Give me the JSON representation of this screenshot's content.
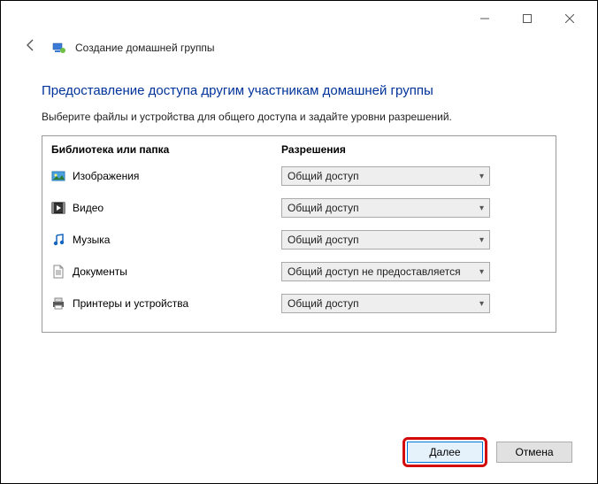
{
  "window": {
    "title": "Создание домашней группы"
  },
  "heading": "Предоставление доступа другим участникам домашней группы",
  "instruction": "Выберите файлы и устройства для общего доступа и задайте уровни разрешений.",
  "columns": {
    "library": "Библиотека или папка",
    "permission": "Разрешения"
  },
  "rows": [
    {
      "icon": "pictures-icon",
      "label": "Изображения",
      "permission": "Общий доступ"
    },
    {
      "icon": "videos-icon",
      "label": "Видео",
      "permission": "Общий доступ"
    },
    {
      "icon": "music-icon",
      "label": "Музыка",
      "permission": "Общий доступ"
    },
    {
      "icon": "documents-icon",
      "label": "Документы",
      "permission": "Общий доступ не предоставляется"
    },
    {
      "icon": "printers-icon",
      "label": "Принтеры и устройства",
      "permission": "Общий доступ"
    }
  ],
  "buttons": {
    "next": "Далее",
    "cancel": "Отмена"
  }
}
